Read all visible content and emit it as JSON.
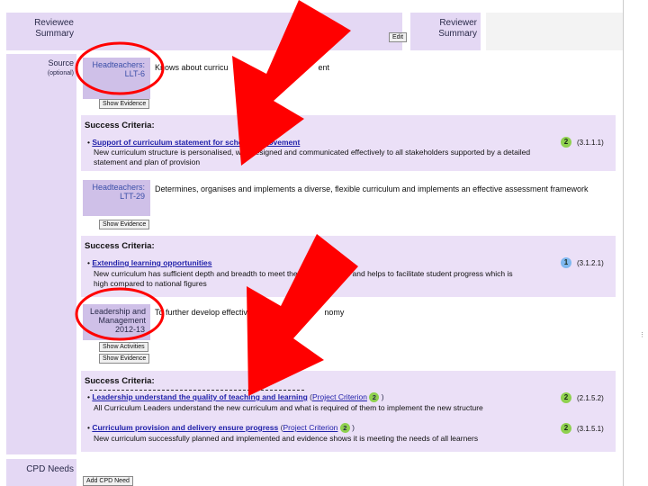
{
  "header": {
    "reviewee_summary": "Reviewee Summary",
    "reviewer_summary": "Reviewer Summary",
    "edit_label": "Edit"
  },
  "source": {
    "label": "Source",
    "sublabel": "(optional)"
  },
  "buttons": {
    "show_evidence": "Show Evidence",
    "show_activities": "Show Activities",
    "add_cpd_need": "Add CPD Need"
  },
  "sections": [
    {
      "source_name": "Headteachers:",
      "source_code": "LLT-6",
      "description": "Knows about curricu",
      "description_tail": "ent",
      "criteria_heading": "Success Criteria:",
      "criteria": [
        {
          "title": "Support of curriculum statement for school improvement",
          "detail_1": "New curriculum structure is personalised, well designed and communicated effectively to all stakeholders supported by a detailed",
          "detail_2": "statement and plan of provision",
          "level": "2",
          "code": "(3.1.1.1)"
        }
      ]
    },
    {
      "source_name": "Headteachers:",
      "source_code": "LTT-29",
      "description": "Determines, organises and implements a diverse, flexible curriculum and implements an effective assessment framework",
      "criteria_heading": "Success Criteria:",
      "criteria": [
        {
          "title": "Extending learning opportunities",
          "detail_1": "New curriculum has sufficient depth and breadth to meet the ne",
          "detail_1_tail": "learners and helps to facilitate student progress which is",
          "detail_2": "high compared to national figures",
          "level": "1",
          "code": "(3.1.2.1)"
        }
      ]
    },
    {
      "source_name": "Leadership and Management",
      "source_code": "2012-13",
      "description": "To further develop effective leade",
      "description_tail": "nomy",
      "criteria_heading": "Success Criteria:",
      "criteria": [
        {
          "title": "Leadership understand the quality of teaching and learning",
          "project_criterion": "Project Criterion",
          "project_level": "2",
          "detail_1": "All Curriculum Leaders understand the new curriculum and what is required of them to implement the new structure",
          "level": "2",
          "code": "(2.1.5.2)"
        },
        {
          "title": "Curriculum provision and delivery ensure progress",
          "project_criterion": "Project Criterion",
          "project_level": "2",
          "detail_1": "New curriculum successfully planned and implemented and evidence shows it is meeting the needs of all learners",
          "level": "2",
          "code": "(3.1.5.1)"
        }
      ]
    }
  ],
  "cpd": {
    "label": "CPD Needs"
  },
  "colors": {
    "panel": "#e4d8f4",
    "source_box": "#cfc0e8",
    "link": "#2222aa",
    "badge_green": "#8fd14f",
    "badge_blue": "#7fb8f0",
    "annotation_red": "#ff0000"
  },
  "annotation": {
    "arrow_icon": "red-arrow-icon",
    "circle_icon": "red-circle-icon"
  }
}
